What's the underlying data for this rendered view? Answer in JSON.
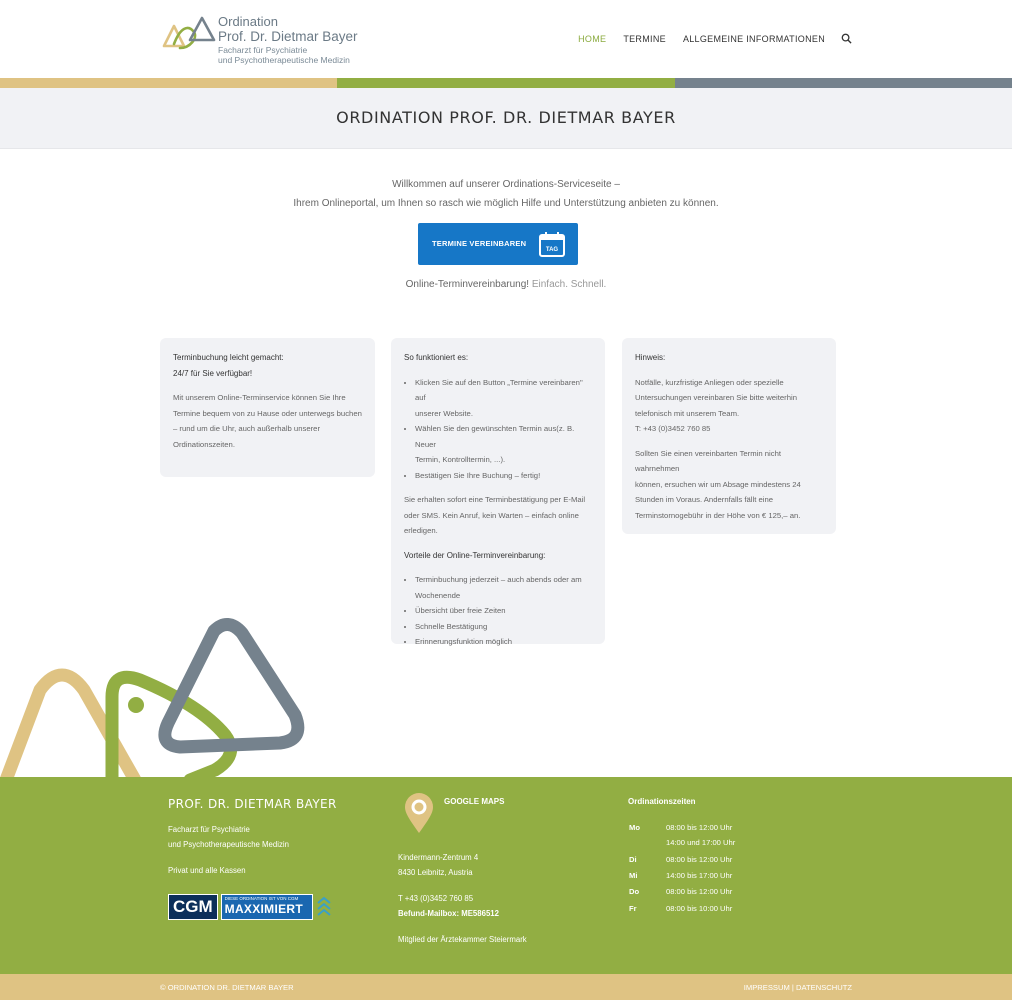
{
  "header": {
    "logo": {
      "title": "Ordination",
      "name": "Prof. Dr. Dietmar Bayer",
      "sub1": "Facharzt für Psychiatrie",
      "sub2": "und Psychotherapeutische Medizin"
    },
    "nav": [
      {
        "label": "HOME",
        "active": true
      },
      {
        "label": "TERMINE",
        "active": false
      },
      {
        "label": "ALLGEMEINE INFORMATIONEN",
        "active": false
      }
    ],
    "search_icon": "search-icon"
  },
  "stripe_colors": [
    "#dfc383",
    "#92ae43",
    "#75828d"
  ],
  "page_title": "ORDINATION PROF. DR. DIETMAR BAYER",
  "intro": {
    "line1": "Willkommen auf unserer Ordinations-Serviceseite –",
    "line2": "Ihrem Onlineportal, um Ihnen so rasch wie möglich Hilfe und Unterstützung anbieten zu können.",
    "button_label": "TERMINE VEREINBAREN",
    "button_icon_text": "TAG",
    "tagline_strong": "Online-Terminvereinbarung!",
    "tagline_light": "Einfach. Schnell."
  },
  "cards": {
    "booking": {
      "heading1": "Terminbuchung leicht gemacht:",
      "heading2": "24/7 für Sie verfügbar!",
      "lines": [
        "Mit unserem Online-Terminservice können Sie Ihre",
        "Termine bequem von zu Hause oder unterwegs buchen",
        "– rund um die Uhr, auch außerhalb unserer",
        "Ordinationszeiten."
      ]
    },
    "how": {
      "heading": "So funktioniert es:",
      "steps": [
        [
          "Klicken Sie auf den Button „Termine vereinbaren\" auf",
          "unserer Website."
        ],
        [
          "Wählen Sie den gewünschten Termin aus(z. B. Neuer",
          "Termin, Kontrolltermin, ...)."
        ],
        [
          "Bestätigen Sie Ihre Buchung – fertig!"
        ]
      ],
      "confirm_lines": [
        "Sie erhalten sofort eine Terminbestätigung per E-Mail",
        "oder SMS. Kein Anruf, kein Warten – einfach online",
        "erledigen."
      ],
      "advantages_heading": "Vorteile der Online-Terminvereinbarung:",
      "advantages": [
        [
          "Terminbuchung jederzeit – auch abends oder am",
          "Wochenende"
        ],
        [
          "Übersicht über freie Zeiten"
        ],
        [
          "Schnelle Bestätigung"
        ],
        [
          "Erinnerungsfunktion möglich"
        ]
      ]
    },
    "notice": {
      "heading": "Hinweis:",
      "para1": [
        "Notfälle, kurzfristige Anliegen oder spezielle",
        "Untersuchungen vereinbaren Sie bitte weiterhin",
        "telefonisch mit unserem Team.",
        "T: +43 (0)3452 760 85"
      ],
      "para2": [
        "Sollten Sie einen vereinbarten Termin nicht wahrnehmen",
        "können, ersuchen wir um Absage mindestens 24",
        "Stunden im Voraus. Andernfalls fällt eine",
        "Terminstornogebühr in der Höhe von € 125,– an."
      ]
    }
  },
  "footer": {
    "brand": "PROF. DR. DIETMAR BAYER",
    "specialty1": "Facharzt für Psychiatrie",
    "specialty2": "und Psychotherapeutische Medizin",
    "insurance": "Privat und alle Kassen",
    "cgm_label": "CGM",
    "maxx_small": "DIESE ORDINATION IST VON CGM",
    "maxx_big": "MAXXIMIERT",
    "maps_label": "GOOGLE MAPS",
    "address1": "Kindermann-Zentrum 4",
    "address2": "8430 Leibnitz, Austria",
    "phone": "T +43 (0)3452 760 85",
    "mailbox": "Befund-Mailbox: ME586512",
    "member": "Mitglied der Ärztekammer Steiermark",
    "hours_title": "Ordinationszeiten",
    "hours": [
      {
        "day": "Mo",
        "time": "08:00 bis 12:00 Uhr"
      },
      {
        "day": "",
        "time": "14:00 und 17:00 Uhr"
      },
      {
        "day": "Di",
        "time": "08:00 bis 12:00 Uhr"
      },
      {
        "day": "Mi",
        "time": "14:00 bis 17:00 Uhr"
      },
      {
        "day": "Do",
        "time": "08:00 bis 12:00 Uhr"
      },
      {
        "day": "Fr",
        "time": "08:00 bis 10:00 Uhr"
      }
    ]
  },
  "bottom": {
    "copyright": "© ORDINATION DR. DIETMAR BAYER",
    "impressum": "IMPRESSUM",
    "separator": "|",
    "datenschutz": "DATENSCHUTZ"
  }
}
